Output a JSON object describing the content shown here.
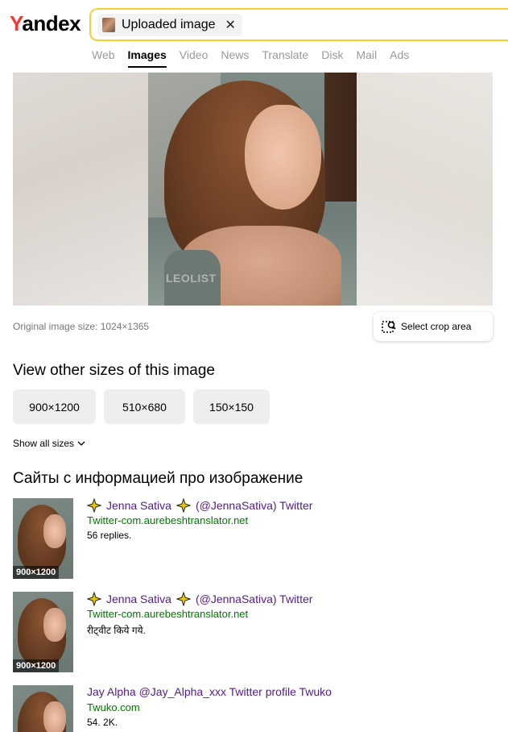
{
  "header": {
    "logo_first": "Y",
    "logo_rest": "andex",
    "search_chip": "Uploaded image",
    "search_chip_close": "✕",
    "nav": [
      {
        "label": "Web",
        "active": false
      },
      {
        "label": "Images",
        "active": true
      },
      {
        "label": "Video",
        "active": false
      },
      {
        "label": "News",
        "active": false
      },
      {
        "label": "Translate",
        "active": false
      },
      {
        "label": "Disk",
        "active": false
      },
      {
        "label": "Mail",
        "active": false
      },
      {
        "label": "Ads",
        "active": false
      }
    ]
  },
  "preview": {
    "watermark": "LEOLIST"
  },
  "image_info": {
    "original_size": "Original image size: 1024×1365",
    "crop_label": "Select crop area"
  },
  "sizes": {
    "title": "View other sizes of this image",
    "options": [
      "900×1200",
      "510×680",
      "150×150"
    ],
    "show_all": "Show all sizes"
  },
  "sites": {
    "title": "Сайты с информацией про изображение",
    "items": [
      {
        "thumb_size": "900×1200",
        "title_text": "Jenna Sativa",
        "title_after": "(@JennaSativa) Twitter",
        "has_icons": true,
        "host": "Twitter-com.aurebeshtranslator.net",
        "desc": "56 replies."
      },
      {
        "thumb_size": "900×1200",
        "title_text": "Jenna Sativa",
        "title_after": "(@JennaSativa) Twitter",
        "has_icons": true,
        "host": "Twitter-com.aurebeshtranslator.net",
        "desc": "रीट्वीट किये गये."
      },
      {
        "thumb_size": "",
        "title_text": "Jay Alpha @Jay_Alpha_xxx Twitter profile Twuko",
        "title_after": "",
        "has_icons": false,
        "host": "Twuko.com",
        "desc": "54. 2K."
      }
    ]
  },
  "colors": {
    "search_border": "#ffcc33",
    "link_title": "#551a8b",
    "host": "#007700",
    "logo_y": "#ff3333"
  }
}
